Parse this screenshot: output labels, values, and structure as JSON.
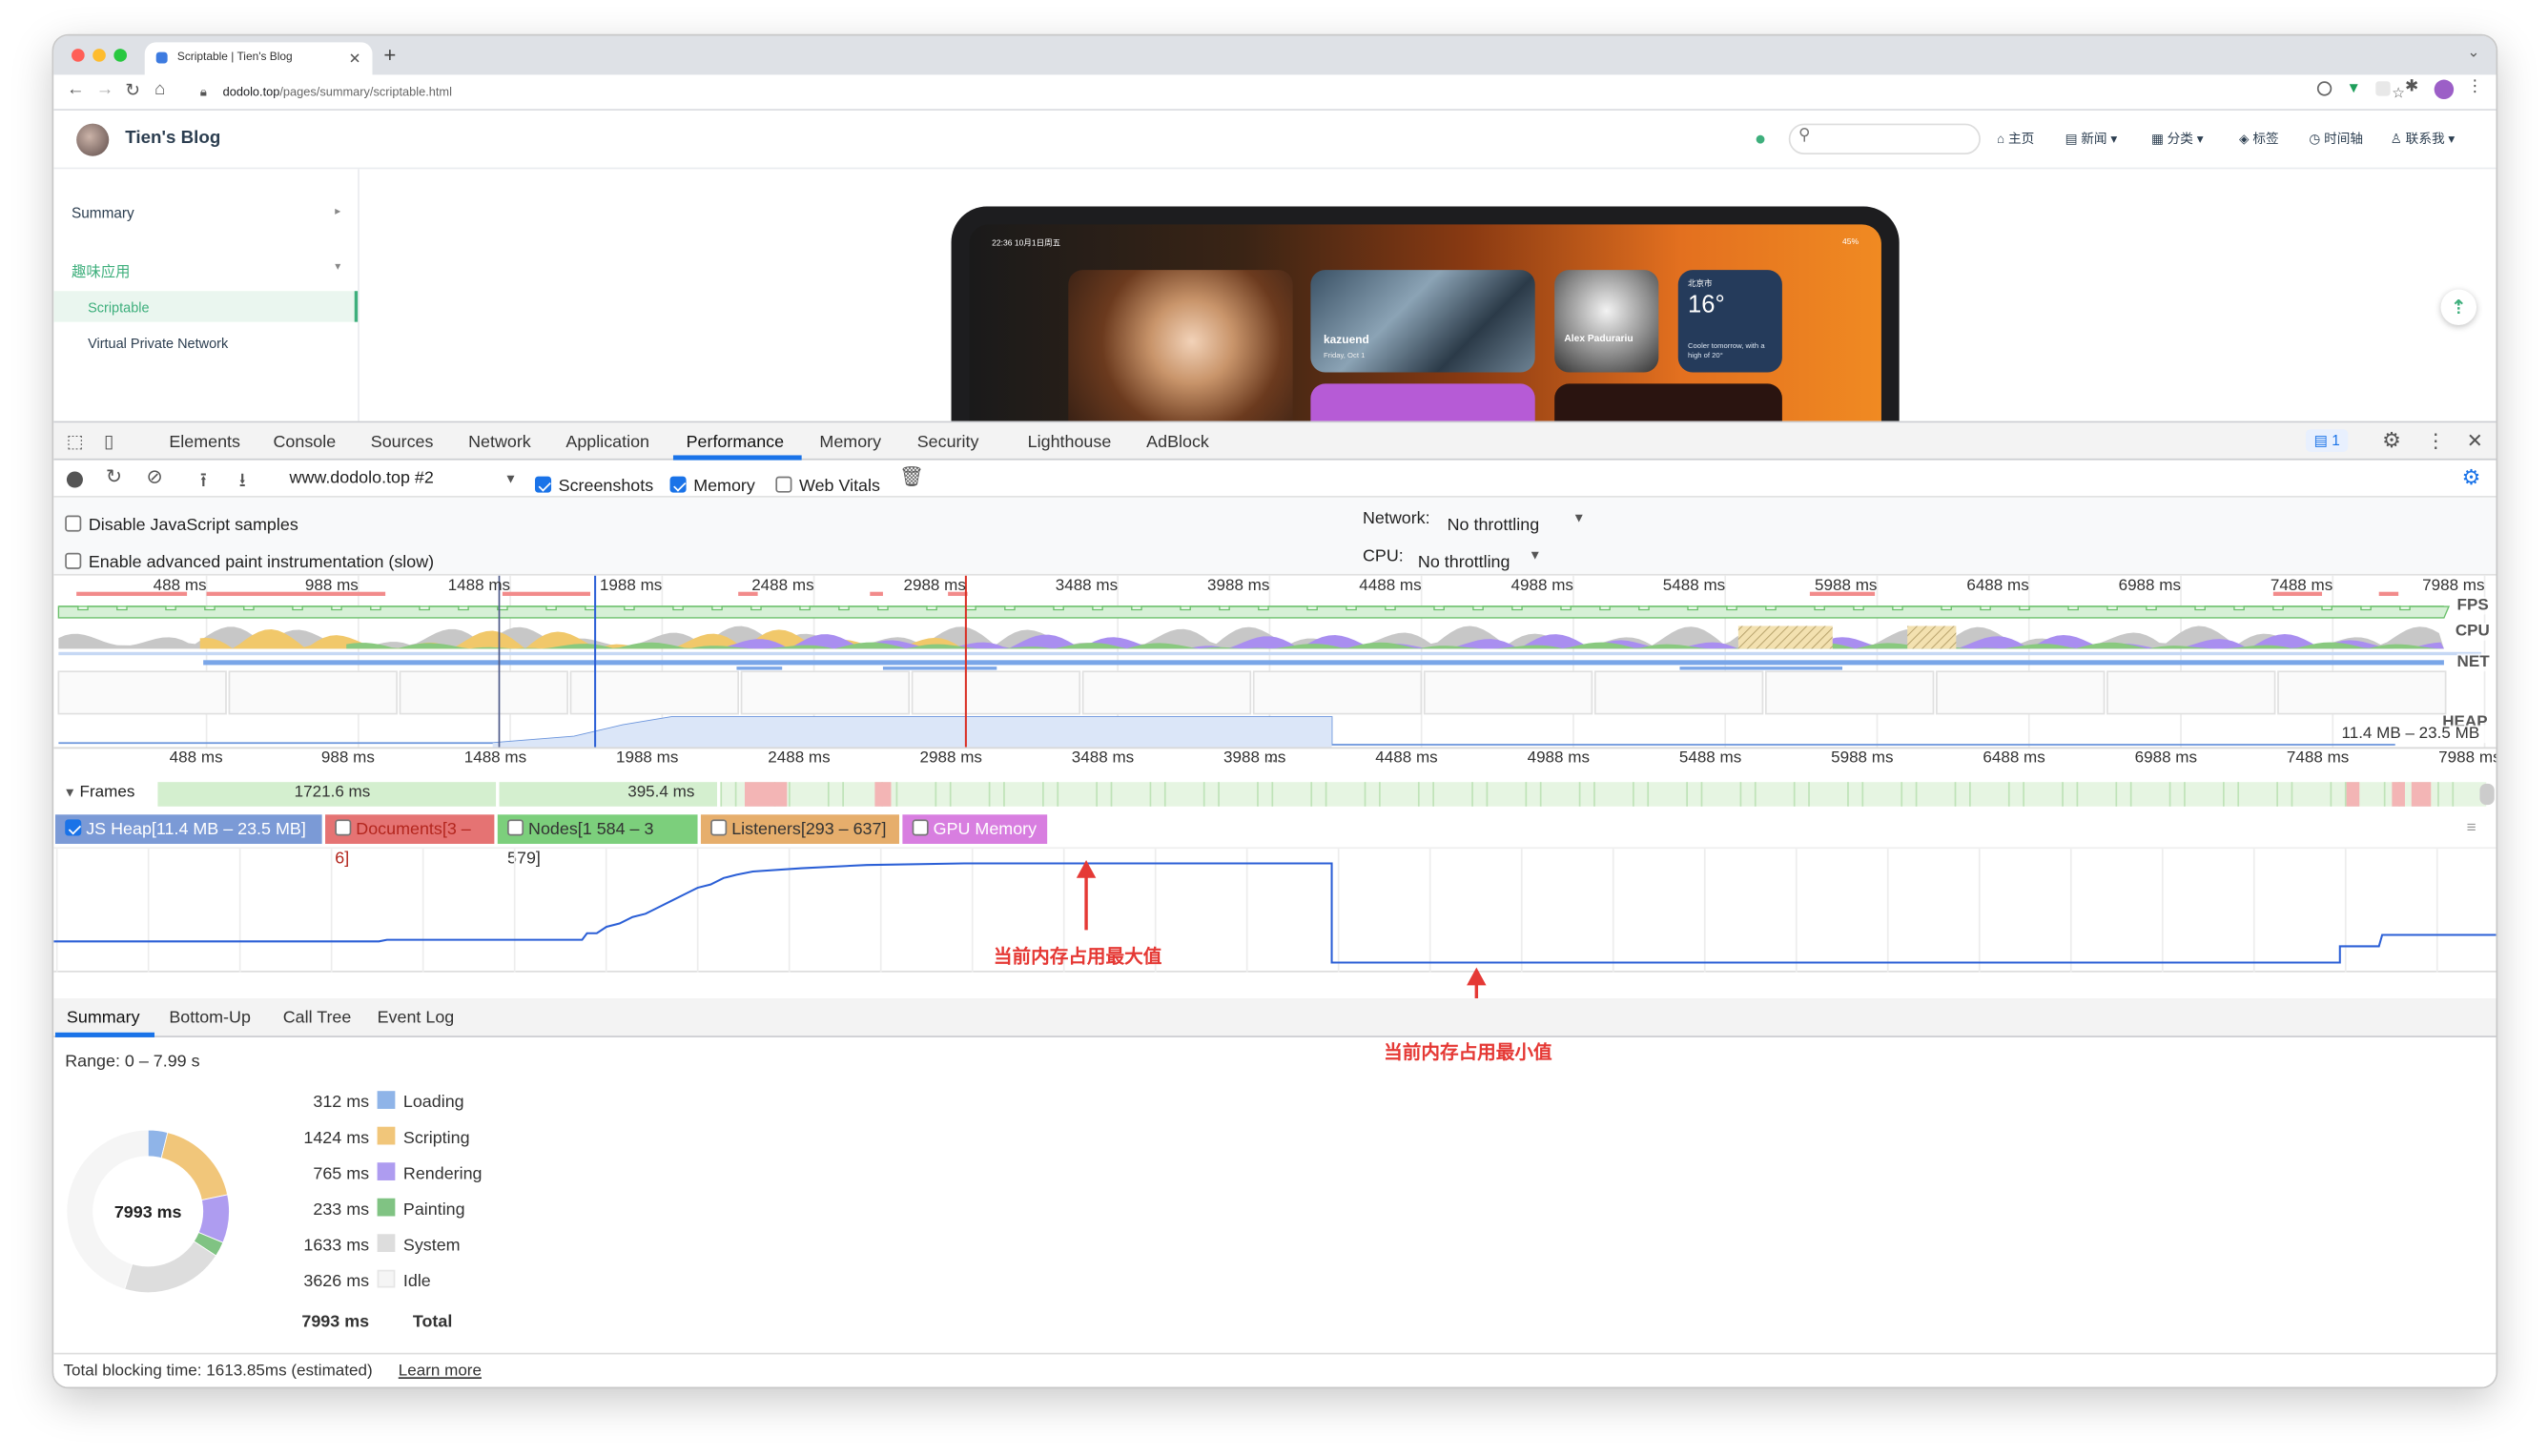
{
  "browser": {
    "tab_title": "Scriptable | Tien's Blog",
    "url_domain": "dodolo.top",
    "url_path": "/pages/summary/scriptable.html"
  },
  "blog": {
    "site_title": "Tien's Blog",
    "nav": {
      "home": "主页",
      "news": "新闻",
      "category": "分类",
      "tags": "标签",
      "timeline": "时间轴",
      "contact": "联系我"
    },
    "sidebar": {
      "summary": "Summary",
      "group": "趣味应用",
      "items": [
        "Scriptable",
        "Virtual Private Network"
      ]
    },
    "ipad": {
      "status_time": "22:36  10月1日周五",
      "status_battery": "45%",
      "card_text": "kazuend",
      "card_date": "Friday, Oct 1",
      "card2_text": "Alex Padurariu",
      "weather_city": "北京市",
      "weather_temp": "16°",
      "weather_note": "Cooler tomorrow, with a high of 20°"
    }
  },
  "devtools": {
    "tabs": [
      "Elements",
      "Console",
      "Sources",
      "Network",
      "Application",
      "Performance",
      "Memory",
      "Security",
      "Lighthouse",
      "AdBlock"
    ],
    "active_tab": "Performance",
    "issues_count": "1",
    "profile_select": "www.dodolo.top #2",
    "opt_screenshots": "Screenshots",
    "opt_memory": "Memory",
    "opt_webvitals": "Web Vitals",
    "opt_disable_js": "Disable JavaScript samples",
    "opt_paint": "Enable advanced paint instrumentation (slow)",
    "network_label": "Network:",
    "network_value": "No throttling",
    "cpu_label": "CPU:",
    "cpu_value": "No throttling",
    "overview_ticks": [
      "488 ms",
      "988 ms",
      "1488 ms",
      "1988 ms",
      "2488 ms",
      "2988 ms",
      "3488 ms",
      "3988 ms",
      "4488 ms",
      "4988 ms",
      "5488 ms",
      "5988 ms",
      "6488 ms",
      "6988 ms",
      "7488 ms",
      "7988 ms"
    ],
    "track_labels": {
      "fps": "FPS",
      "cpu": "CPU",
      "net": "NET",
      "heap": "HEAP"
    },
    "heap_range": "11.4 MB – 23.5 MB",
    "frames_label": "Frames",
    "frame_values": [
      "1721.6 ms",
      "395.4 ms"
    ],
    "memory_legend": [
      {
        "label": "JS Heap[11.4 MB – 23.5 MB]",
        "checked": true,
        "color": "#7b9ad6"
      },
      {
        "label": "Documents[3 – 6]",
        "checked": false,
        "color": "#e57373"
      },
      {
        "label": "Nodes[1 584 – 3 579]",
        "checked": false,
        "color": "#7ccf7c"
      },
      {
        "label": "Listeners[293 – 637]",
        "checked": false,
        "color": "#e6ae6c"
      },
      {
        "label": "GPU Memory",
        "checked": false,
        "color": "#d87ee0"
      }
    ],
    "annotation_max": "当前内存占用最大值",
    "annotation_min": "当前内存占用最小值",
    "bottom_tabs": [
      "Summary",
      "Bottom-Up",
      "Call Tree",
      "Event Log"
    ],
    "range": "Range: 0 – 7.99 s",
    "pie_center": "7993 ms",
    "summary": [
      {
        "ms": "312 ms",
        "label": "Loading",
        "color": "#8fb4e8",
        "value": 312
      },
      {
        "ms": "1424 ms",
        "label": "Scripting",
        "color": "#f1c67a",
        "value": 1424
      },
      {
        "ms": "765 ms",
        "label": "Rendering",
        "color": "#ae9cf0",
        "value": 765
      },
      {
        "ms": "233 ms",
        "label": "Painting",
        "color": "#80c383",
        "value": 233
      },
      {
        "ms": "1633 ms",
        "label": "System",
        "color": "#dddddd",
        "value": 1633
      },
      {
        "ms": "3626 ms",
        "label": "Idle",
        "color": "#f5f5f5",
        "value": 3626
      }
    ],
    "total_ms": "7993 ms",
    "total_label": "Total",
    "blocking": "Total blocking time: 1613.85ms (estimated)",
    "learn_more": "Learn more"
  }
}
